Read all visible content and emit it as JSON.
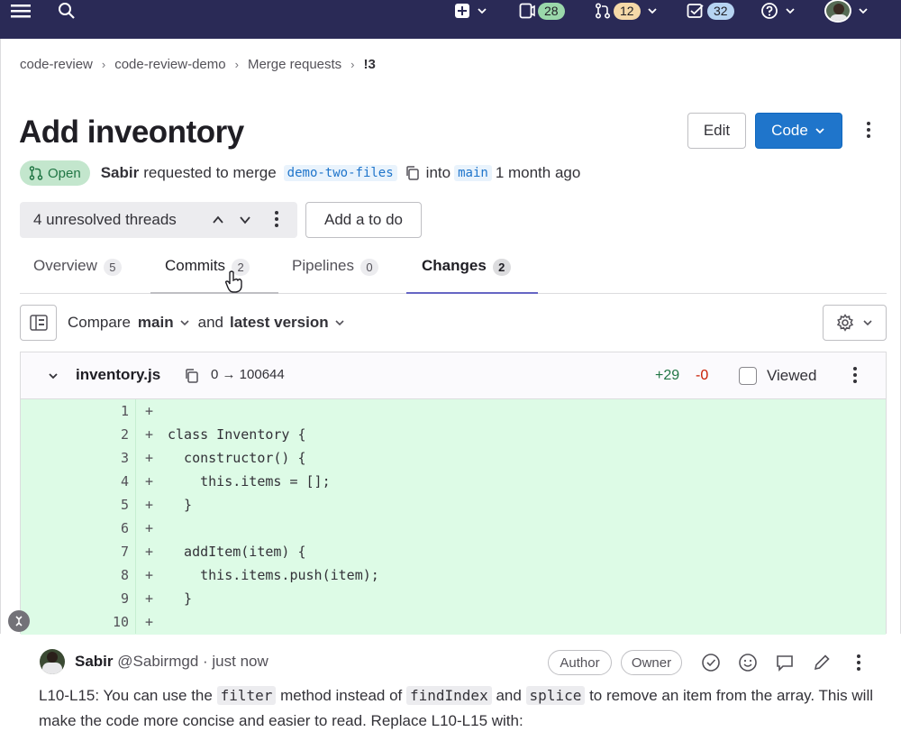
{
  "topbar": {
    "counts": {
      "issues": "28",
      "merge_requests": "12",
      "todos": "32"
    }
  },
  "breadcrumb": [
    "code-review",
    "code-review-demo",
    "Merge requests",
    "!3"
  ],
  "mr": {
    "title": "Add inveontory",
    "status": "Open",
    "author": "Sabir",
    "requested_text": "requested to merge",
    "source_branch": "demo-two-files",
    "into_text": "into",
    "target_branch": "main",
    "time_ago": "1 month ago"
  },
  "actions": {
    "edit": "Edit",
    "code": "Code"
  },
  "threads": {
    "label": "4 unresolved threads",
    "todo": "Add a to do"
  },
  "tabs": [
    {
      "label": "Overview",
      "count": "5"
    },
    {
      "label": "Commits",
      "count": "2"
    },
    {
      "label": "Pipelines",
      "count": "0"
    },
    {
      "label": "Changes",
      "count": "2"
    }
  ],
  "compare": {
    "label": "Compare",
    "base": "main",
    "and": "and",
    "version": "latest version"
  },
  "file": {
    "name": "inventory.js",
    "mode": "0 → 100644",
    "added": "+29",
    "removed": "-0",
    "viewed": "Viewed"
  },
  "code_lines": [
    {
      "n": "1",
      "text": ""
    },
    {
      "n": "2",
      "text": "class Inventory {"
    },
    {
      "n": "3",
      "text": "  constructor() {"
    },
    {
      "n": "4",
      "text": "    this.items = [];"
    },
    {
      "n": "5",
      "text": "  }"
    },
    {
      "n": "6",
      "text": ""
    },
    {
      "n": "7",
      "text": "  addItem(item) {"
    },
    {
      "n": "8",
      "text": "    this.items.push(item);"
    },
    {
      "n": "9",
      "text": "  }"
    },
    {
      "n": "10",
      "text": ""
    }
  ],
  "comment": {
    "author": "Sabir",
    "handle": "@Sabirmgd",
    "time": "· just now",
    "role_author": "Author",
    "role_owner": "Owner",
    "text_1": "L10-L15: You can use the",
    "code_1": "filter",
    "text_2": "method instead of",
    "code_2": "findIndex",
    "text_3": "and",
    "code_3": "splice",
    "text_4": "to remove an item from the array. This will make the code more concise and easier to read. Replace L10-L15 with:"
  },
  "colors": {
    "nav": "#2a2a56",
    "primary": "#1f75cb",
    "added_bg": "#ddfbe6",
    "open_badge": "#c3e6cd"
  }
}
